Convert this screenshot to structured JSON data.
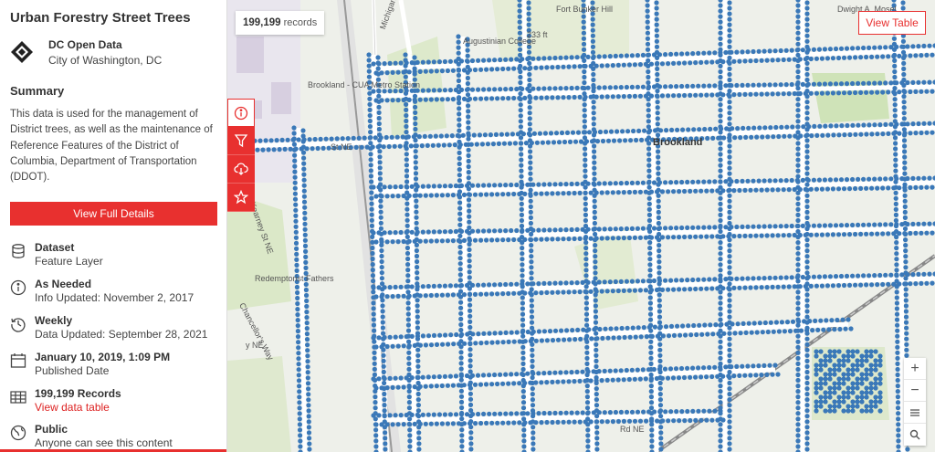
{
  "panel": {
    "title": "Urban Forestry Street Trees",
    "publisher": "DC Open Data",
    "publisher_sub": "City of Washington, DC",
    "summary_heading": "Summary",
    "summary_text": "This data is used for the management of District trees, as well as the maintenance of Reference Features of the District of Columbia, Department of Transportation (DDOT).",
    "details_button": "View Full Details",
    "meta": [
      {
        "icon": "dataset-icon",
        "title": "Dataset",
        "sub": "Feature Layer"
      },
      {
        "icon": "info-icon",
        "title": "As Needed",
        "sub": "Info Updated: November 2, 2017"
      },
      {
        "icon": "history-icon",
        "title": "Weekly",
        "sub": "Data Updated: September 28, 2021"
      },
      {
        "icon": "calendar-icon",
        "title": "January 10, 2019, 1:09 PM",
        "sub": "Published Date"
      },
      {
        "icon": "table-icon",
        "title": "199,199 Records",
        "sub": "View data table"
      },
      {
        "icon": "globe-icon",
        "title": "Public",
        "sub": "Anyone can see this content"
      }
    ]
  },
  "side_tools": [
    "info-icon",
    "filter-icon",
    "cloud-download-icon",
    "star-icon"
  ],
  "map": {
    "records_count": "199,199",
    "records_label": "records",
    "view_table_button": "View Table",
    "labels": {
      "brookland": "Brookland",
      "michigan": "Michigan Ave",
      "augustinian": "Augustinian College",
      "fort_bunker": "Fort Bunker Hill",
      "elev_233": "233 ft",
      "brookland_metro": "Brookland - CUA Metro Station",
      "st_ne": "St NE",
      "kearney": "Kearney St NE",
      "redemptorist": "Redemptorist Fathers",
      "chancellors": "Chancellor's Way",
      "dwight": "Dwight A. Mosel",
      "rd_ne": "Rd NE",
      "y_ne": "y NE"
    },
    "colors": {
      "tree_dot": "#3a78b8",
      "accent": "#e8302f",
      "park": "#d8e6c2",
      "road": "#ffffff"
    }
  }
}
